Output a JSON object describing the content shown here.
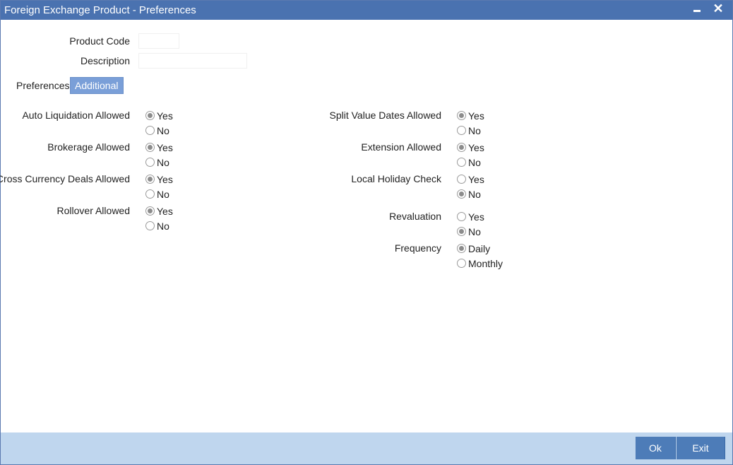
{
  "window": {
    "title": "Foreign Exchange Product - Preferences",
    "minimize_icon": "minimize-icon",
    "close_icon": "close-icon",
    "close_glyph": "✕"
  },
  "header": {
    "product_code_label": "Product Code",
    "product_code_value": "",
    "description_label": "Description",
    "description_value": ""
  },
  "tabs": [
    {
      "label": "Preferences",
      "active": false
    },
    {
      "label": "Additional",
      "active": true
    }
  ],
  "left_options": [
    {
      "label": "Auto Liquidation Allowed",
      "yes": "Yes",
      "no": "No",
      "selected": "Yes"
    },
    {
      "label": "Brokerage Allowed",
      "yes": "Yes",
      "no": "No",
      "selected": "Yes"
    },
    {
      "label": "Cross Currency Deals Allowed",
      "yes": "Yes",
      "no": "No",
      "selected": "Yes"
    },
    {
      "label": "Rollover Allowed",
      "yes": "Yes",
      "no": "No",
      "selected": "Yes"
    }
  ],
  "right_options": [
    {
      "label": "Split Value Dates Allowed",
      "yes": "Yes",
      "no": "No",
      "selected": "Yes"
    },
    {
      "label": "Extension Allowed",
      "yes": "Yes",
      "no": "No",
      "selected": "Yes"
    },
    {
      "label": "Local Holiday Check",
      "yes": "Yes",
      "no": "No",
      "selected": "No"
    },
    {
      "label": "Revaluation",
      "yes": "Yes",
      "no": "No",
      "selected": "No"
    },
    {
      "label": "Frequency",
      "yes": "Daily",
      "no": "Monthly",
      "selected": "Daily"
    }
  ],
  "footer": {
    "ok_label": "Ok",
    "exit_label": "Exit"
  },
  "colors": {
    "titlebar": "#4a72b0",
    "active_tab": "#7a9fd8",
    "footer": "#bfd6ee",
    "button": "#4d7cb8"
  }
}
